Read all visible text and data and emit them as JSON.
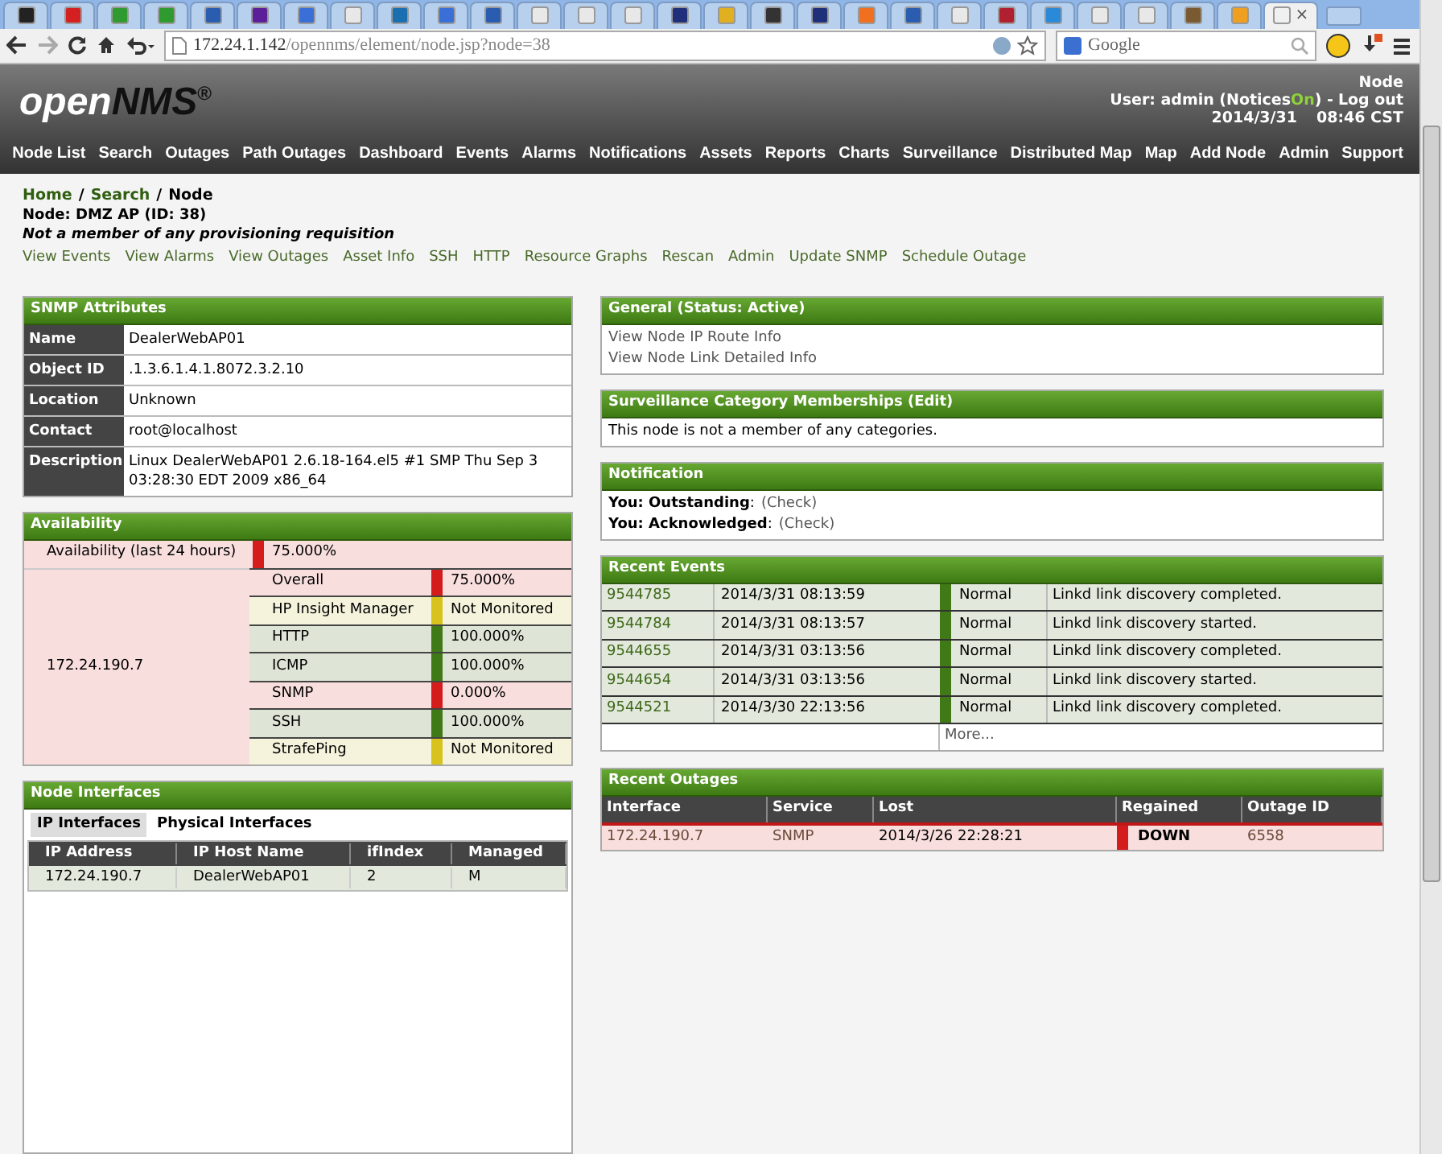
{
  "browser": {
    "tabs": [
      {
        "color": "#222222",
        "selected": false
      },
      {
        "color": "#d42020",
        "selected": false
      },
      {
        "color": "#2f9a2f",
        "selected": false
      },
      {
        "color": "#2f9a2f",
        "selected": false
      },
      {
        "color": "#2a5db0",
        "selected": false
      },
      {
        "color": "#5b1f9a",
        "selected": false
      },
      {
        "color": "#3a6fd8",
        "selected": false
      },
      {
        "color": "#e8e8e8",
        "selected": false
      },
      {
        "color": "#1a6fb0",
        "selected": false
      },
      {
        "color": "#3a6fd8",
        "selected": false
      },
      {
        "color": "#2a5db0",
        "selected": false
      },
      {
        "color": "#e8e8e8",
        "selected": false
      },
      {
        "color": "#e8e8e8",
        "selected": false
      },
      {
        "color": "#e8e8e8",
        "selected": false
      },
      {
        "color": "#1f2f7a",
        "selected": false
      },
      {
        "color": "#e0b020",
        "selected": false
      },
      {
        "color": "#333333",
        "selected": false
      },
      {
        "color": "#1f2f7a",
        "selected": false
      },
      {
        "color": "#f07020",
        "selected": false
      },
      {
        "color": "#2a5db0",
        "selected": false
      },
      {
        "color": "#e8e8e8",
        "selected": false
      },
      {
        "color": "#b02030",
        "selected": false
      },
      {
        "color": "#2a8ad8",
        "selected": false
      },
      {
        "color": "#e8e8e8",
        "selected": false
      },
      {
        "color": "#e8e8e8",
        "selected": false
      },
      {
        "color": "#7a5a30",
        "selected": false
      },
      {
        "color": "#f0a020",
        "selected": false
      },
      {
        "color": "#f0f0f0",
        "selected": true,
        "close": "×"
      }
    ],
    "url_host": "172.24.1.142",
    "url_path": "/opennms/element/node.jsp?node=38",
    "search_placeholder": "Google"
  },
  "header": {
    "logo_open": "open",
    "logo_nms": "NMS",
    "logo_mark": "®",
    "page": "Node",
    "user_text": "User: admin (Notices",
    "notices_state": "On",
    "user_after": ") -",
    "logout": "Log out",
    "date": "2014/3/31",
    "time": "08:46 CST",
    "nav": [
      "Node List",
      "Search",
      "Outages",
      "Path Outages",
      "Dashboard",
      "Events",
      "Alarms",
      "Notifications",
      "Assets",
      "Reports",
      "Charts",
      "Surveillance",
      "Distributed Map",
      "Map",
      "Add Node",
      "Admin",
      "Support"
    ]
  },
  "breadcrumb": [
    {
      "label": "Home",
      "kind": "link"
    },
    {
      "label": "/",
      "kind": "sep"
    },
    {
      "label": "Search",
      "kind": "link"
    },
    {
      "label": "/",
      "kind": "sep"
    },
    {
      "label": "Node",
      "kind": "current"
    }
  ],
  "node_title": "Node: DMZ AP (ID: 38)",
  "requisition": "Not a member of any provisioning requisition",
  "actions": [
    "View Events",
    "View Alarms",
    "View Outages",
    "Asset Info",
    "SSH",
    "HTTP",
    "Resource Graphs",
    "Rescan",
    "Admin",
    "Update SNMP",
    "Schedule Outage"
  ],
  "snmp": {
    "title": "SNMP Attributes",
    "rows": [
      {
        "label": "Name",
        "value": "DealerWebAP01"
      },
      {
        "label": "Object ID",
        "value": ".1.3.6.1.4.1.8072.3.2.10"
      },
      {
        "label": "Location",
        "value": "Unknown"
      },
      {
        "label": "Contact",
        "value": "root@localhost"
      },
      {
        "label": "Description",
        "value": "Linux DealerWebAP01 2.6.18-164.el5 #1 SMP Thu Sep 3 03:28:30 EDT 2009 x86_64"
      }
    ]
  },
  "availability": {
    "title": "Availability",
    "summary": {
      "label": "Availability (last 24 hours)",
      "value": "75.000%",
      "kind": "down"
    },
    "interface": "172.24.190.7",
    "services": [
      {
        "name": "Overall",
        "value": "75.000%",
        "kind": "down"
      },
      {
        "name": "HP Insight Manager",
        "value": "Not Monitored",
        "kind": "unmonitored"
      },
      {
        "name": "HTTP",
        "value": "100.000%",
        "kind": "up"
      },
      {
        "name": "ICMP",
        "value": "100.000%",
        "kind": "up"
      },
      {
        "name": "SNMP",
        "value": "0.000%",
        "kind": "down"
      },
      {
        "name": "SSH",
        "value": "100.000%",
        "kind": "up"
      },
      {
        "name": "StrafePing",
        "value": "Not Monitored",
        "kind": "unmonitored"
      }
    ]
  },
  "interfaces": {
    "title": "Node Interfaces",
    "tabs": [
      {
        "label": "IP Interfaces",
        "selected": true
      },
      {
        "label": "Physical Interfaces",
        "selected": false
      }
    ],
    "columns": [
      "IP Address",
      "IP Host Name",
      "ifIndex",
      "Managed"
    ],
    "rows": [
      [
        "172.24.190.7",
        "DealerWebAP01",
        "2",
        "M"
      ]
    ]
  },
  "general": {
    "title": "General (Status: Active)",
    "links": [
      "View Node IP Route Info",
      "View Node Link Detailed Info"
    ]
  },
  "surveillance": {
    "title": "Surveillance Category Memberships (Edit)",
    "text": "This node is not a member of any categories."
  },
  "notification": {
    "title": "Notification",
    "rows": [
      {
        "label": "You: Outstanding",
        "sep": ":",
        "link": "(Check)"
      },
      {
        "label": "You: Acknowledged",
        "sep": ":",
        "link": "(Check)"
      }
    ]
  },
  "events": {
    "title": "Recent Events",
    "rows": [
      {
        "id": "9544785",
        "time": "2014/3/31 08:13:59",
        "severity": "Normal",
        "message": "Linkd link discovery completed."
      },
      {
        "id": "9544784",
        "time": "2014/3/31 08:13:57",
        "severity": "Normal",
        "message": "Linkd link discovery started."
      },
      {
        "id": "9544655",
        "time": "2014/3/31 03:13:56",
        "severity": "Normal",
        "message": "Linkd link discovery completed."
      },
      {
        "id": "9544654",
        "time": "2014/3/31 03:13:56",
        "severity": "Normal",
        "message": "Linkd link discovery started."
      },
      {
        "id": "9544521",
        "time": "2014/3/30 22:13:56",
        "severity": "Normal",
        "message": "Linkd link discovery completed."
      }
    ],
    "more": "More..."
  },
  "outages": {
    "title": "Recent Outages",
    "columns": [
      "Interface",
      "Service",
      "Lost",
      "Regained",
      "Outage ID"
    ],
    "rows": [
      {
        "interface": "172.24.190.7",
        "service": "SNMP",
        "lost": "2014/3/26 22:28:21",
        "regained": "DOWN",
        "id": "6558"
      }
    ]
  }
}
